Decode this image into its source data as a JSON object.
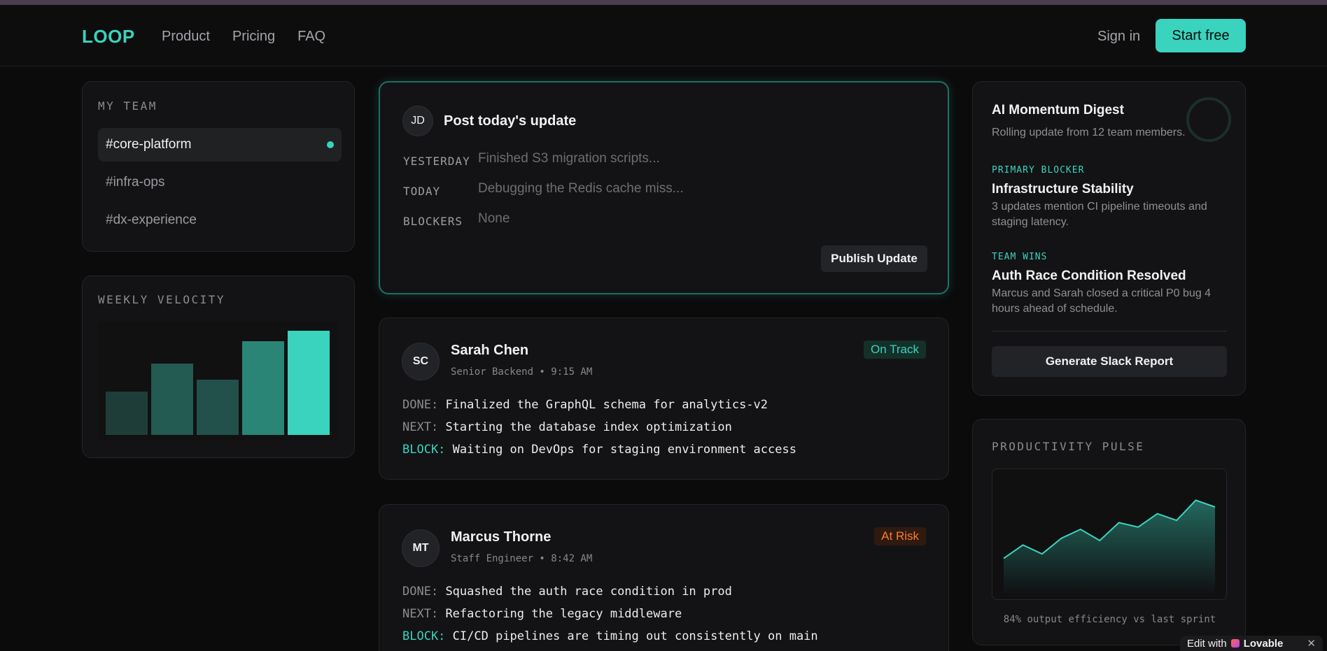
{
  "header": {
    "logo": "LOOP",
    "nav": [
      "Product",
      "Pricing",
      "FAQ"
    ],
    "sign_in": "Sign in",
    "start_free": "Start free"
  },
  "team": {
    "label": "MY TEAM",
    "items": [
      {
        "label": "#core-platform",
        "active": true
      },
      {
        "label": "#infra-ops",
        "active": false
      },
      {
        "label": "#dx-experience",
        "active": false
      }
    ]
  },
  "velocity": {
    "label": "WEEKLY VELOCITY",
    "values": [
      40,
      66,
      51,
      87,
      97
    ],
    "colors": [
      "#1f3d38",
      "#235a52",
      "#22504a",
      "#2a8577",
      "#3ad3bd"
    ]
  },
  "post": {
    "avatar": "JD",
    "title": "Post today's update",
    "yesterday_label": "YESTERDAY",
    "yesterday_placeholder": "Finished S3 migration scripts...",
    "today_label": "TODAY",
    "today_placeholder": "Debugging the Redis cache miss...",
    "blockers_label": "BLOCKERS",
    "blockers_placeholder": "None",
    "publish": "Publish Update"
  },
  "updates": [
    {
      "initials": "SC",
      "name": "Sarah Chen",
      "meta": "Senior Backend • 9:15 AM",
      "status": "On Track",
      "done_key": "DONE:",
      "done": "Finalized the GraphQL schema for analytics-v2",
      "next_key": "NEXT:",
      "next": "Starting the database index optimization",
      "block_key": "BLOCK:",
      "block": "Waiting on DevOps for staging environment access"
    },
    {
      "initials": "MT",
      "name": "Marcus Thorne",
      "meta": "Staff Engineer • 8:42 AM",
      "status": "At Risk",
      "done_key": "DONE:",
      "done": "Squashed the auth race condition in prod",
      "next_key": "NEXT:",
      "next": "Refactoring the legacy middleware",
      "block_key": "BLOCK:",
      "block": "CI/CD pipelines are timing out consistently on main"
    }
  ],
  "digest": {
    "title": "AI Momentum Digest",
    "subtitle": "Rolling update from 12 team members.",
    "blocker_label": "PRIMARY BLOCKER",
    "blocker_title": "Infrastructure Stability",
    "blocker_text": "3 updates mention CI pipeline timeouts and staging latency.",
    "wins_label": "TEAM WINS",
    "wins_title": "Auth Race Condition Resolved",
    "wins_text": "Marcus and Sarah closed a critical P0 bug 4 hours ahead of schedule.",
    "button": "Generate Slack Report"
  },
  "pulse": {
    "label": "PRODUCTIVITY PULSE",
    "values": [
      22,
      28,
      24,
      31,
      35,
      30,
      38,
      36,
      42,
      39,
      48,
      45
    ],
    "caption": "84% output efficiency vs last sprint"
  },
  "edit_chip": {
    "text": "Edit with",
    "brand": "Lovable",
    "close": "✕"
  }
}
